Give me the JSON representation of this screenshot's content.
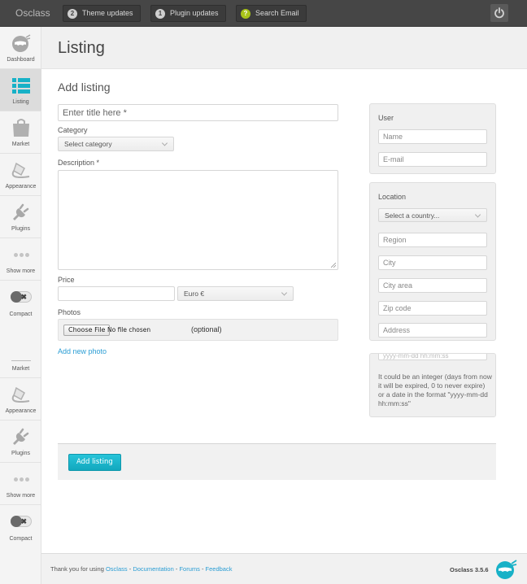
{
  "topbar": {
    "brand": "Osclass",
    "buttons": [
      {
        "badge": "2",
        "label": "Theme updates"
      },
      {
        "badge": "1",
        "label": "Plugin updates"
      },
      {
        "badge": "?",
        "label": "Search Email"
      }
    ],
    "power_icon": "power-icon"
  },
  "sidebar": {
    "items": [
      {
        "label": "Dashboard",
        "icon": "dashboard-icon"
      },
      {
        "label": "Listing",
        "icon": "listing-icon",
        "active": true
      },
      {
        "label": "Market",
        "icon": "market-bag-icon"
      },
      {
        "label": "Appearance",
        "icon": "paint-bucket-icon"
      },
      {
        "label": "Plugins",
        "icon": "plug-icon"
      },
      {
        "label": "Show more",
        "icon": "more-dots-icon"
      },
      {
        "label": "Compact",
        "icon": "toggle-icon"
      }
    ],
    "items_repeat": [
      {
        "label": "Market"
      },
      {
        "label": "Appearance",
        "icon": "paint-bucket-icon"
      },
      {
        "label": "Plugins",
        "icon": "plug-icon"
      },
      {
        "label": "Show more",
        "icon": "more-dots-icon"
      },
      {
        "label": "Compact",
        "icon": "toggle-icon"
      }
    ]
  },
  "page": {
    "title": "Listing",
    "section_title": "Add listing"
  },
  "form": {
    "title_placeholder": "Enter title here *",
    "category_label": "Category",
    "category_value": "Select category",
    "description_label": "Description *",
    "price_label": "Price",
    "price_value": "",
    "currency_value": "Euro €",
    "photos_label": "Photos",
    "choose_file": "Choose File",
    "file_status": "No file chosen",
    "optional": "(optional)",
    "add_photo": "Add new photo",
    "submit": "Add listing"
  },
  "user_panel": {
    "title": "User",
    "name_placeholder": "Name",
    "email_placeholder": "E-mail"
  },
  "location_panel": {
    "title": "Location",
    "country_value": "Select a country...",
    "region_placeholder": "Region",
    "city_placeholder": "City",
    "city_area_placeholder": "City area",
    "zip_placeholder": "Zip code",
    "address_placeholder": "Address"
  },
  "expiration_panel": {
    "input_placeholder": "yyyy-mm-dd hh:mm:ss",
    "help": "It could be an integer (days from now it will be expired, 0 to never expire) or a date in the format \"yyyy-mm-dd hh:mm:ss\""
  },
  "footer": {
    "prefix": "Thank you for using ",
    "links": [
      "Osclass",
      "Documentation",
      "Forums",
      "Feedback"
    ],
    "separator": " - ",
    "version": "Osclass 3.5.6"
  },
  "colors": {
    "accent": "#17b1c7",
    "link": "#2a9dd4",
    "topbar": "#464646",
    "badge_green": "#a9c319"
  }
}
